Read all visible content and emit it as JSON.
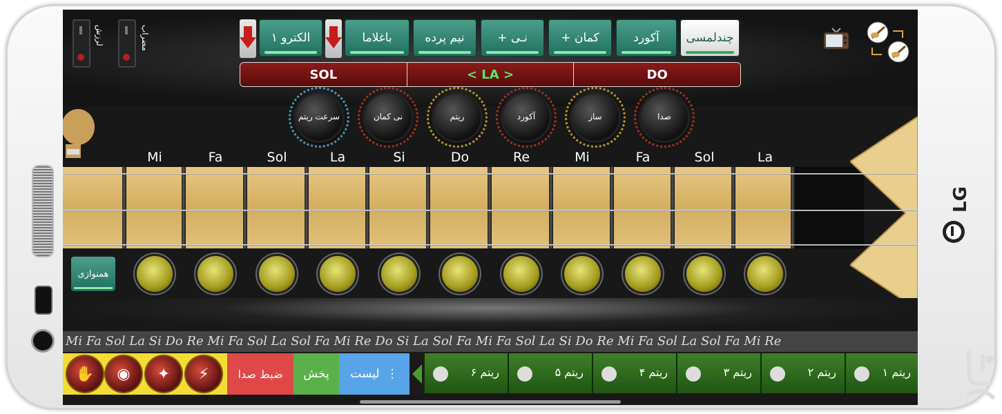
{
  "side": {
    "switch1": "لرزش",
    "switch2": "مضراب"
  },
  "tabs": [
    {
      "label": "چندلمسی",
      "active": true
    },
    {
      "label": "آکورد"
    },
    {
      "label": "+ کمان"
    },
    {
      "label": "+ نـی"
    },
    {
      "label": "نیم پرده"
    },
    {
      "label": "باغلاما"
    },
    {
      "label": "الکترو ۱"
    }
  ],
  "tuning": {
    "left": "SOL",
    "middle": "< LA >",
    "right": "DO"
  },
  "knobs": [
    "سرعت ریتم",
    "نی کمان",
    "ریتم",
    "آکورد",
    "ساز",
    "صدا"
  ],
  "notes": [
    "Mi",
    "Fa",
    "Sol",
    "La",
    "Si",
    "Do",
    "Re",
    "Mi",
    "Fa",
    "Sol",
    "La"
  ],
  "hamnavazi": "همنوازی",
  "ticker": "Mi Fa Sol La Si Do Re Mi Fa Sol La Sol Fa Mi Re Do Si La Sol Fa Mi Fa Sol La Si Do Re Mi Fa Sol La Sol Fa Mi Re",
  "bottom": {
    "record": "ضبط صدا",
    "play": "پخش",
    "list": "لیست",
    "rhythms": [
      "ریتم ۶",
      "ریتم ۵",
      "ریتم ۴",
      "ریتم ۳",
      "ریتم ۲",
      "ریتم ۱"
    ]
  },
  "brand": "LG",
  "colors": {
    "accent": "#1f6f5d",
    "selected_tuning": "#57e86b",
    "record": "#e04848",
    "play": "#5ab04a",
    "list": "#58a4e8"
  }
}
